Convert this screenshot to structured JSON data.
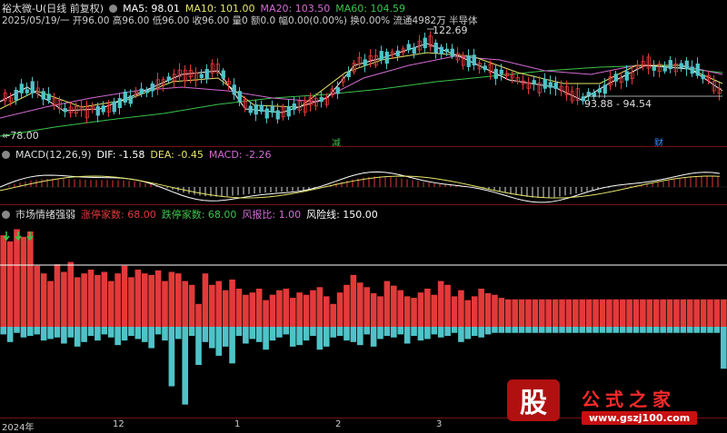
{
  "header": {
    "stock": "裕太微-U(日线 前复权)",
    "ma5": "MA5: 98.01",
    "ma10": "MA10: 101.00",
    "ma20": "MA20: 103.50",
    "ma60": "MA60: 104.59",
    "info": "2025/05/19/一 开96.00 高96.00 低96.00 收96.00 量0 额0.0 幅0.00(0.00%) 换0.00% 流通4982万 半导体"
  },
  "price_panel": {
    "high_label": "122.69",
    "low_label": "↞78.00",
    "range_label": "93.88 - 94.54",
    "marker1": "减",
    "marker2": "财"
  },
  "macd_panel": {
    "title": "MACD(12,26,9)",
    "dif": "DIF: -1.58",
    "dea": "DEA: -0.45",
    "macd": "MACD: -2.26"
  },
  "sentiment_panel": {
    "title": "市场情绪强弱",
    "limit_up": "涨停家数: 68.00",
    "limit_down": "跌停家数: 68.00",
    "ratio": "风报比: 1.00",
    "risk_line": "风险线: 150.00"
  },
  "x_axis": [
    "2024年",
    "12",
    "1",
    "2",
    "3"
  ],
  "watermark": {
    "logo_char": "股",
    "title": "公式之家",
    "url": "www.gszj100.com"
  },
  "colors": {
    "up": "#e23a3a",
    "down": "#4fc3c8",
    "ma5": "#ffffff",
    "ma10": "#e6e66a",
    "ma20": "#d36bd3",
    "ma60": "#3cc34a",
    "separator": "#7a1010",
    "risk_line": "#ffffff"
  },
  "sentiment_bars": {
    "red": [
      120,
      112,
      128,
      118,
      125,
      80,
      70,
      60,
      82,
      72,
      85,
      65,
      70,
      75,
      68,
      72,
      60,
      70,
      80,
      65,
      75,
      70,
      68,
      74,
      60,
      72,
      70,
      60,
      55,
      30,
      70,
      55,
      60,
      48,
      62,
      50,
      42,
      45,
      50,
      35,
      42,
      48,
      50,
      38,
      45,
      42,
      48,
      52,
      40,
      30,
      45,
      55,
      68,
      58,
      52,
      44,
      40,
      60,
      54,
      48,
      40,
      38,
      45,
      50,
      42,
      60,
      55,
      40,
      48,
      35,
      40,
      50,
      44,
      42,
      38,
      36,
      36,
      36,
      36,
      36,
      36,
      36,
      36,
      36,
      36,
      36,
      36,
      36,
      36,
      36,
      36,
      36,
      36,
      36,
      36,
      36,
      36,
      36,
      36,
      36,
      36,
      36,
      36,
      36,
      36,
      36,
      36,
      36
    ],
    "cyan": [
      10,
      20,
      8,
      14,
      12,
      10,
      18,
      16,
      14,
      22,
      14,
      26,
      20,
      12,
      18,
      10,
      14,
      24,
      18,
      12,
      16,
      20,
      28,
      10,
      18,
      78,
      16,
      102,
      12,
      50,
      20,
      28,
      38,
      26,
      48,
      12,
      22,
      16,
      20,
      30,
      18,
      14,
      10,
      26,
      24,
      18,
      12,
      30,
      26,
      14,
      12,
      18,
      20,
      24,
      10,
      26,
      16,
      12,
      14,
      10,
      22,
      12,
      18,
      16,
      10,
      14,
      12,
      8,
      20,
      16,
      12,
      14,
      10,
      8,
      8,
      8,
      8,
      8,
      8,
      8,
      8,
      8,
      8,
      8,
      8,
      8,
      8,
      8,
      8,
      8,
      8,
      8,
      8,
      8,
      8,
      8,
      8,
      8,
      8,
      8,
      8,
      8,
      8,
      8,
      8,
      8,
      8,
      55
    ]
  }
}
